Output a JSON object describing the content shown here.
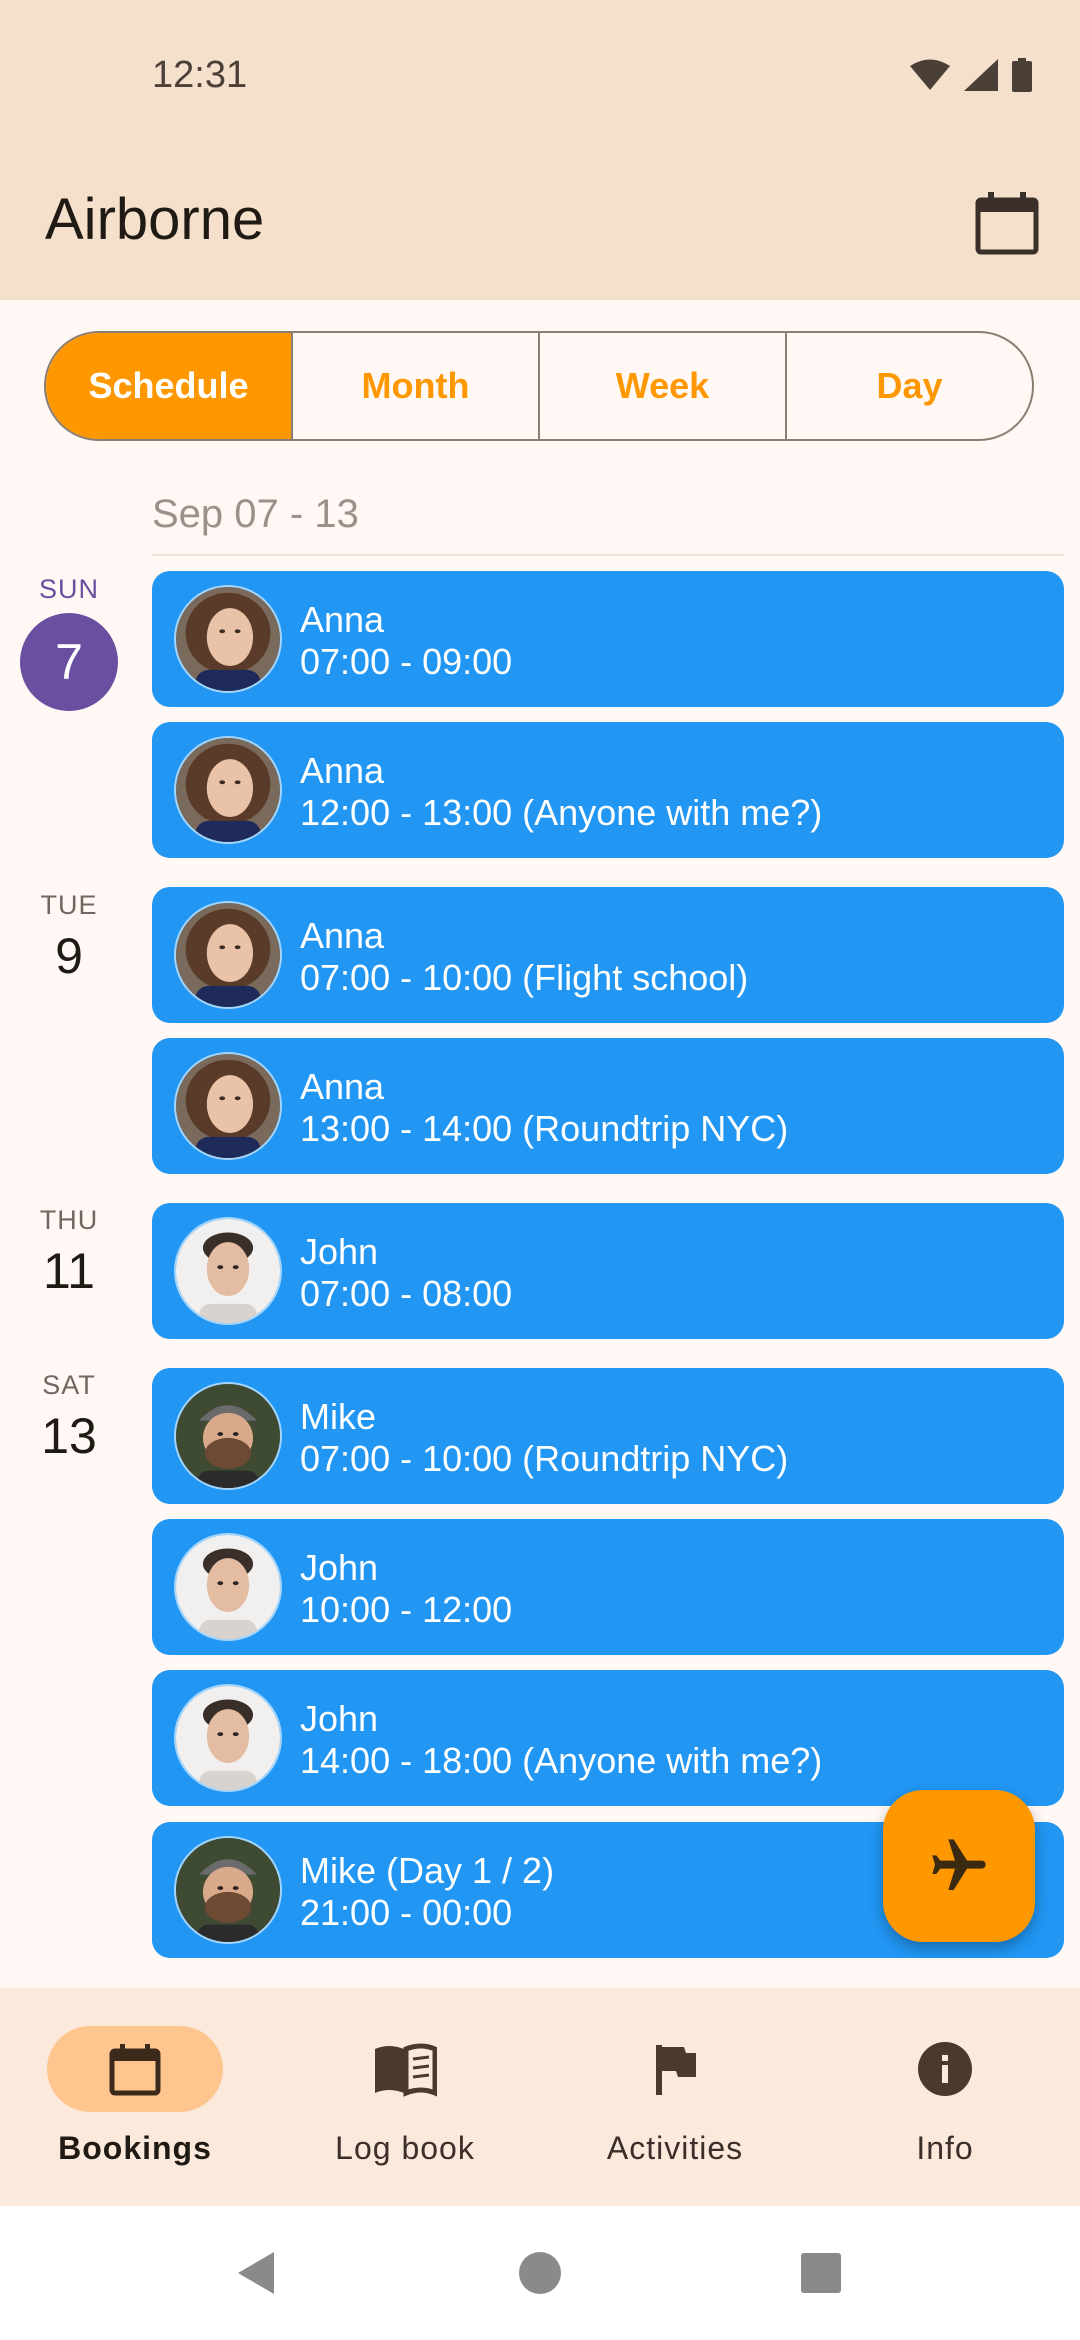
{
  "status": {
    "time": "12:31"
  },
  "app": {
    "title": "Airborne"
  },
  "tabs": [
    {
      "label": "Schedule",
      "active": true
    },
    {
      "label": "Month",
      "active": false
    },
    {
      "label": "Week",
      "active": false
    },
    {
      "label": "Day",
      "active": false
    }
  ],
  "schedule": {
    "week_range": "Sep 07 - 13",
    "days": [
      {
        "name": "SUN",
        "num": "7"
      },
      {
        "name": "TUE",
        "num": "9"
      },
      {
        "name": "THU",
        "num": "11"
      },
      {
        "name": "SAT",
        "num": "13"
      }
    ],
    "events": [
      {
        "name": "Anna",
        "time": "07:00 - 09:00",
        "avatar": "anna"
      },
      {
        "name": "Anna",
        "time": "12:00 - 13:00 (Anyone with me?)",
        "avatar": "anna"
      },
      {
        "name": "Anna",
        "time": "07:00 - 10:00 (Flight school)",
        "avatar": "anna"
      },
      {
        "name": "Anna",
        "time": "13:00 - 14:00 (Roundtrip NYC)",
        "avatar": "anna"
      },
      {
        "name": "John",
        "time": "07:00 - 08:00",
        "avatar": "john"
      },
      {
        "name": "Mike",
        "time": "07:00 - 10:00 (Roundtrip NYC)",
        "avatar": "mike"
      },
      {
        "name": "John",
        "time": "10:00 - 12:00",
        "avatar": "john"
      },
      {
        "name": "John",
        "time": "14:00 - 18:00 (Anyone with me?)",
        "avatar": "john"
      },
      {
        "name": "Mike (Day 1 / 2)",
        "time": "21:00 - 00:00",
        "avatar": "mike"
      }
    ]
  },
  "fab": {
    "icon": "airplane-icon"
  },
  "nav": [
    {
      "label": "Bookings",
      "icon": "calendar-icon",
      "active": true
    },
    {
      "label": "Log book",
      "icon": "book-icon",
      "active": false
    },
    {
      "label": "Activities",
      "icon": "flag-icon",
      "active": false
    },
    {
      "label": "Info",
      "icon": "info-icon",
      "active": false
    }
  ],
  "colors": {
    "accent": "#FF9800",
    "event": "#2196F3",
    "today": "#6A4FA0",
    "appbar": "#F4E0CB"
  }
}
